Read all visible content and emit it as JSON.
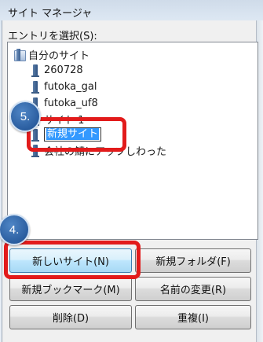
{
  "window": {
    "title": "サイト マネージャ"
  },
  "tree": {
    "label": "エントリを選択(S):",
    "root": "自分のサイト",
    "items": [
      {
        "label": "260728"
      },
      {
        "label": "futoka_gal"
      },
      {
        "label": "futoka_uf8"
      },
      {
        "label": "サイト 1"
      },
      {
        "label": "新規サイト",
        "editing": true
      },
      {
        "label": "会社の鯖にアップしわった"
      }
    ]
  },
  "buttons": {
    "new_site": "新しいサイト(N)",
    "new_folder": "新規フォルダ(F)",
    "new_bookmark": "新規ブックマーク(M)",
    "rename": "名前の変更(R)",
    "delete": "削除(D)",
    "duplicate": "重複(I)"
  },
  "annotations": {
    "step_new_site": "4.",
    "step_rename": "5."
  },
  "colors": {
    "highlight": "#e21b1b",
    "badge": "#2a5d9f",
    "selection": "#3399ff"
  }
}
